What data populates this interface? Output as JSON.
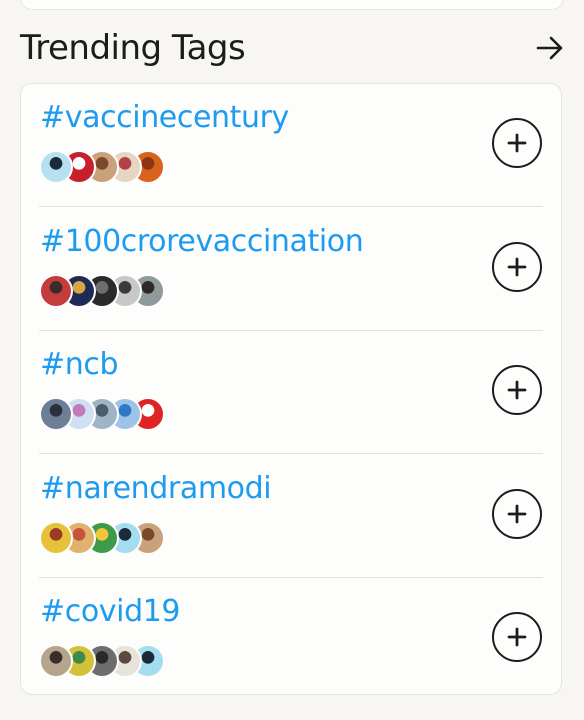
{
  "section": {
    "title": "Trending Tags",
    "see_all_icon": "arrow-right-icon"
  },
  "tags": [
    {
      "name": "#vaccinecentury",
      "avatars": [
        {
          "icon": "user-avatar",
          "colors": [
            "#b6e0f0",
            "#1d2a3a"
          ]
        },
        {
          "icon": "ndtv-logo-avatar",
          "colors": [
            "#c71f2b",
            "#ffffff"
          ]
        },
        {
          "icon": "user-avatar",
          "colors": [
            "#c9a27c",
            "#7a4a2c"
          ]
        },
        {
          "icon": "user-avatar",
          "colors": [
            "#e5d6c4",
            "#b3414a"
          ]
        },
        {
          "icon": "orange-avatar",
          "colors": [
            "#d9621c",
            "#8c3510"
          ]
        }
      ]
    },
    {
      "name": "#100crorevaccination",
      "avatars": [
        {
          "icon": "user-avatar",
          "colors": [
            "#c43c3c",
            "#3a2c2a"
          ]
        },
        {
          "icon": "emblem-avatar",
          "colors": [
            "#1f2b55",
            "#d6a640"
          ]
        },
        {
          "icon": "user-avatar",
          "colors": [
            "#2a2a2a",
            "#6d6d6d"
          ]
        },
        {
          "icon": "user-avatar",
          "colors": [
            "#c8c8c8",
            "#3b3b3b"
          ]
        },
        {
          "icon": "user-avatar",
          "colors": [
            "#8f9a9a",
            "#2e2a26"
          ]
        }
      ]
    },
    {
      "name": "#ncb",
      "avatars": [
        {
          "icon": "user-avatar",
          "colors": [
            "#6d7f96",
            "#2a2f3a"
          ]
        },
        {
          "icon": "letter-a-avatar",
          "colors": [
            "#cfe0f4",
            "#c27ab8"
          ]
        },
        {
          "icon": "user-avatar",
          "colors": [
            "#9fb4c6",
            "#4b5c6e"
          ]
        },
        {
          "icon": "verified-avatar",
          "colors": [
            "#9fc3e8",
            "#2f78c9"
          ]
        },
        {
          "icon": "abp-live-avatar",
          "colors": [
            "#e02424",
            "#ffffff"
          ]
        }
      ]
    },
    {
      "name": "#narendramodi",
      "avatars": [
        {
          "icon": "user-avatar",
          "colors": [
            "#e8c13a",
            "#9c3a2a"
          ]
        },
        {
          "icon": "user-avatar",
          "colors": [
            "#e0b26d",
            "#c4553a"
          ]
        },
        {
          "icon": "flag-avatar",
          "colors": [
            "#3d9a4a",
            "#f3c53a"
          ]
        },
        {
          "icon": "user-avatar",
          "colors": [
            "#a4dcf0",
            "#1d2a3a"
          ]
        },
        {
          "icon": "user-avatar",
          "colors": [
            "#c9a27c",
            "#7a4a2c"
          ]
        }
      ]
    },
    {
      "name": "#covid19",
      "avatars": [
        {
          "icon": "user-avatar",
          "colors": [
            "#b4a58c",
            "#3b2e26"
          ]
        },
        {
          "icon": "flag-avatar",
          "colors": [
            "#d4c13a",
            "#3d8a4a"
          ]
        },
        {
          "icon": "user-avatar",
          "colors": [
            "#6d6d6d",
            "#2a2a2a"
          ]
        },
        {
          "icon": "user-avatar",
          "colors": [
            "#e7e2da",
            "#5c4a3e"
          ]
        },
        {
          "icon": "user-avatar",
          "colors": [
            "#a4dcf0",
            "#1d2a3a"
          ]
        }
      ]
    }
  ],
  "follow_icon": "plus-icon"
}
